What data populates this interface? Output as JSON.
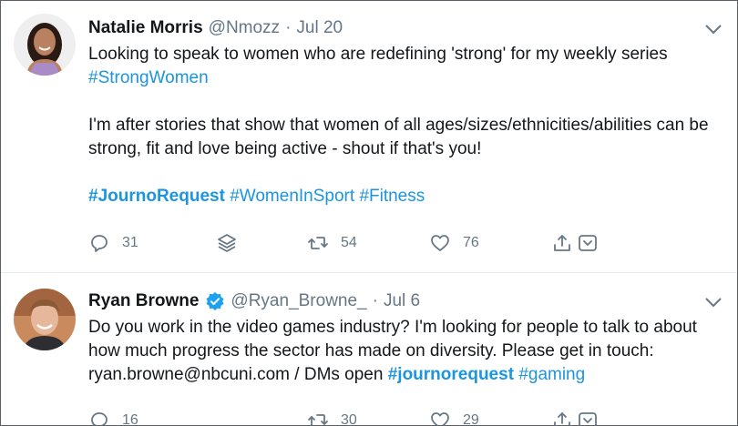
{
  "tweets": [
    {
      "name": "Natalie Morris",
      "handle": "@Nmozz",
      "dot": "·",
      "date": "Jul 20",
      "verified": false,
      "body": {
        "p1_text": "Looking to speak to women who are redefining 'strong' for my weekly series",
        "p1_tag": "#StrongWomen",
        "p2_text": "I'm after stories that show that women of all ages/sizes/ethnicities/abilities can be strong, fit and love being active - shout if that's you!",
        "tag_journo": "#JournoRequest",
        "tag_women": "#WomenInSport",
        "tag_fitness": "#Fitness"
      },
      "actions": {
        "replies": "31",
        "retweets": "54",
        "likes": "76"
      }
    },
    {
      "name": "Ryan Browne",
      "handle": "@Ryan_Browne_",
      "dot": "·",
      "date": "Jul 6",
      "verified": true,
      "body": {
        "text": "Do you work in the video games industry? I'm looking for people to talk to about how much progress the sector has made on diversity. Please get in touch: ryan.browne@nbcuni.com / DMs open",
        "tag_journo": "#journorequest",
        "tag_gaming": "#gaming"
      },
      "actions": {
        "replies": "16",
        "retweets": "30",
        "likes": "29"
      }
    }
  ],
  "icons": {
    "reply": "reply-icon",
    "stack": "stack-icon",
    "retweet": "retweet-icon",
    "like": "heart-icon",
    "share": "share-icon",
    "save": "save-icon",
    "more": "chevron-down-icon",
    "verified": "verified-badge-icon"
  },
  "colors": {
    "text": "#14171a",
    "muted": "#657786",
    "link": "#1b95e0",
    "verified": "#1da1f2"
  }
}
